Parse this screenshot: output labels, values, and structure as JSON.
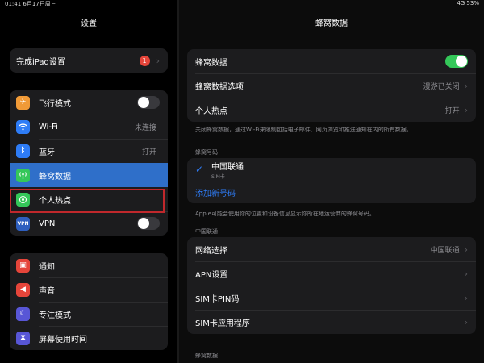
{
  "status": {
    "time_date": "01:41 6月17日周三",
    "battery": "4G 53%"
  },
  "sidebar": {
    "title": "设置",
    "finish_setup": {
      "label": "完成iPad设置",
      "badge": "1"
    },
    "group1": [
      {
        "label": "飞行模式",
        "icon": "airplane-icon",
        "color": "#f09a37",
        "accessory": "toggle-off"
      },
      {
        "label": "Wi-Fi",
        "icon": "wifi-icon",
        "color": "#2e7cf6",
        "value": "未连接"
      },
      {
        "label": "蓝牙",
        "icon": "bluetooth-icon",
        "color": "#2e7cf6",
        "value": "打开"
      },
      {
        "label": "蜂窝数据",
        "icon": "cellular-icon",
        "color": "#34c759",
        "selected": true
      },
      {
        "label": "个人热点",
        "icon": "hotspot-icon",
        "color": "#34c759"
      },
      {
        "label": "VPN",
        "icon": "vpn-icon",
        "color": "#2e5fbf",
        "accessory": "toggle-off"
      }
    ],
    "group2": [
      {
        "label": "通知",
        "icon": "notifications-icon",
        "color": "#e5453a"
      },
      {
        "label": "声音",
        "icon": "sounds-icon",
        "color": "#e5453a"
      },
      {
        "label": "专注模式",
        "icon": "focus-icon",
        "color": "#5856d6"
      },
      {
        "label": "屏幕使用时间",
        "icon": "screen-time-icon",
        "color": "#5856d6"
      }
    ]
  },
  "main": {
    "title": "蜂窝数据",
    "card1": [
      {
        "label": "蜂窝数据",
        "accessory": "toggle-on"
      },
      {
        "label": "蜂窝数据选项",
        "value": "漫游已关闭"
      },
      {
        "label": "个人热点",
        "value": "打开"
      }
    ],
    "note1": "关闭蜂窝数据，通过Wi-Fi来限制包括电子邮件、网页浏览和推送通知在内的所有数据。",
    "section_numbers": "蜂窝号码",
    "carrier": {
      "name": "中国联通",
      "sub": "SIM卡"
    },
    "add_number": "添加新号码",
    "note2": "Apple可能会使用你的位置和设备信息显示你所在地运营商的蜂窝号码。",
    "section_carrier": "中国联通",
    "card3": [
      {
        "label": "网络选择",
        "value": "中国联通"
      },
      {
        "label": "APN设置"
      },
      {
        "label": "SIM卡PIN码"
      },
      {
        "label": "SIM卡应用程序"
      }
    ],
    "section_data": "蜂窝数据"
  }
}
